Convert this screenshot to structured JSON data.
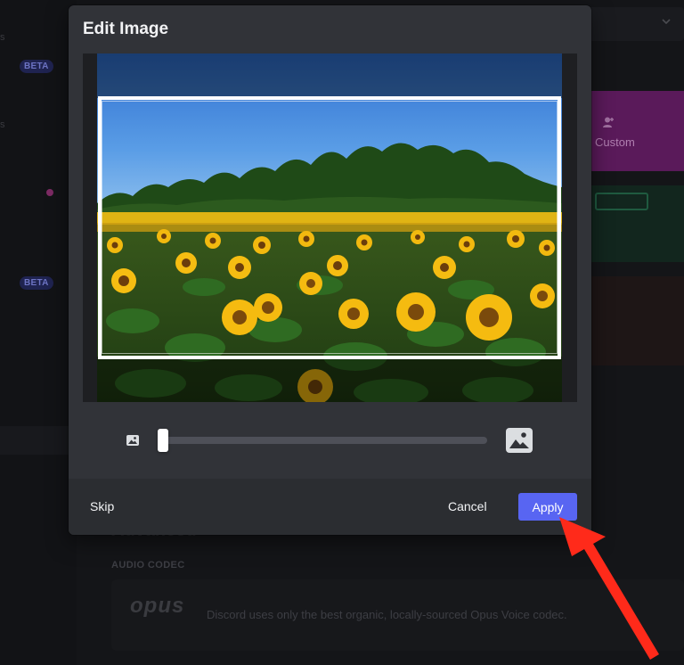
{
  "background": {
    "badges": [
      "BETA",
      "BETA"
    ],
    "custom_label": "Custom",
    "section_title": "Advanced",
    "codec_label": "AUDIO CODEC",
    "codec_logo": "opus",
    "codec_description": "Discord uses only the best organic, locally-sourced Opus Voice codec."
  },
  "modal": {
    "title": "Edit Image",
    "zoom": {
      "level_percent": 0,
      "small_icon": "image-small-icon",
      "large_icon": "image-large-icon"
    },
    "footer": {
      "skip_label": "Skip",
      "cancel_label": "Cancel",
      "apply_label": "Apply"
    }
  },
  "colors": {
    "modal_bg": "#313338",
    "footer_bg": "#2b2d31",
    "accent": "#5865f2",
    "annotation_arrow": "#ff2a1a"
  }
}
